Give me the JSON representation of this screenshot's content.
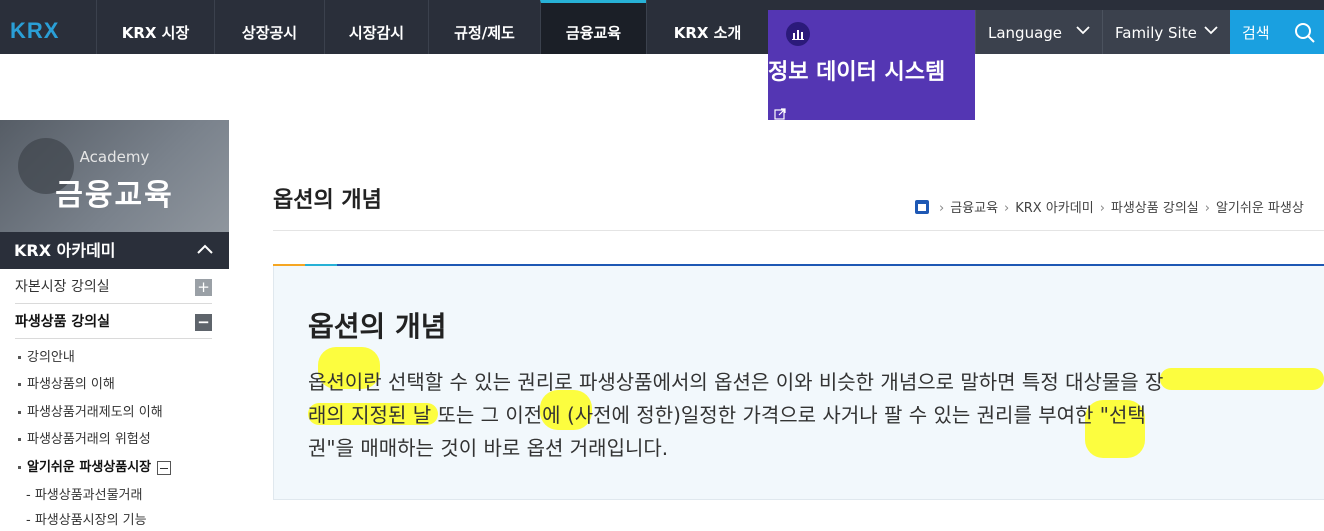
{
  "header": {
    "logo": "KRX",
    "nav": [
      "KRX 시장",
      "상장공시",
      "시장감시",
      "규정/제도",
      "금융교육",
      "KRX 소개"
    ],
    "active_nav": "금융교육",
    "info_menu_title": "정보 데이터 시스템",
    "language_label": "Language",
    "family_site_label": "Family Site",
    "search_label": "검색"
  },
  "sidebar": {
    "banner_sub": "Academy",
    "banner_main": "금융교육",
    "section_title": "KRX 아카데미",
    "rows": [
      "자본시장 강의실",
      "파생상품 강의실"
    ],
    "sub_items": [
      "강의안내",
      "파생상품의 이해",
      "파생상품거래제도의 이해",
      "파생상품거래의 위험성",
      "알기쉬운 파생상품시장"
    ],
    "sub_sub_items": [
      "파생상품과선물거래",
      "파생상품시장의 기능"
    ]
  },
  "main": {
    "page_title": "옵션의 개념",
    "breadcrumb": [
      "금융교육",
      "KRX 아카데미",
      "파생상품 강의실",
      "알기쉬운 파생상"
    ],
    "content_title": "옵션의 개념",
    "content_lines": [
      "옵션이란 선택할 수 있는 권리로 파생상품에서의 옵션은 이와 비슷한 개념으로 말하면 특정 대상물을 장",
      "래의 지정된 날 또는 그 이전에 (사전에 정한)일정한 가격으로 사거나 팔 수 있는 권리를 부여한 \"선택",
      "권\"을 매매하는 것이 바로 옵션 거래입니다."
    ]
  },
  "colors": {
    "topbar": "#2a2f3a",
    "info_menu": "#5436b3",
    "search": "#1aa0e0",
    "content_bg": "#f2f8fc",
    "highlight": "#ffff00"
  }
}
